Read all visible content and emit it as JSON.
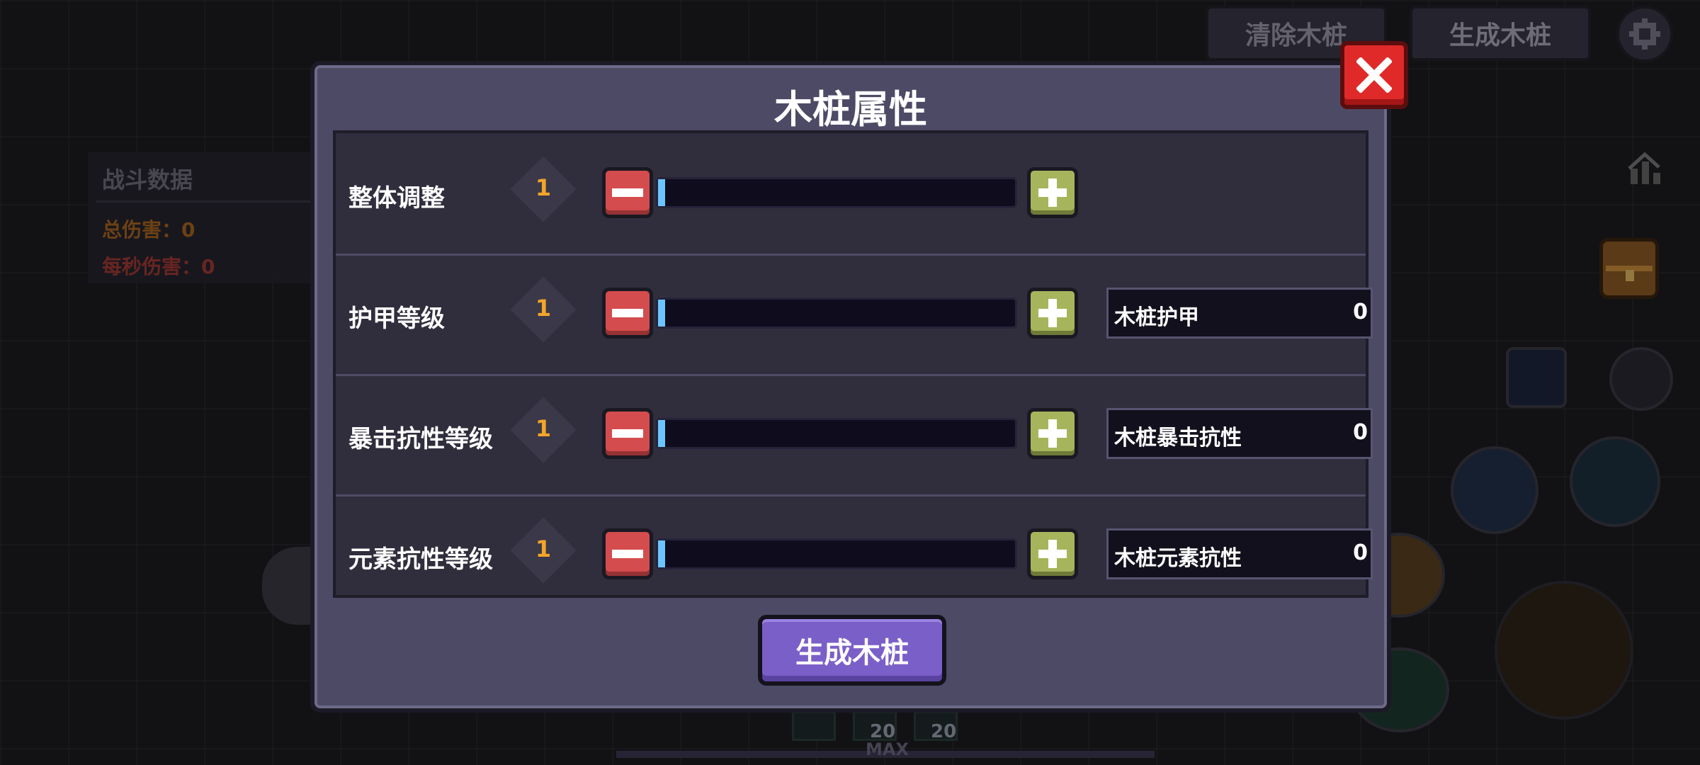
{
  "top_bar": {
    "clear_label": "清除木桩",
    "spawn_label": "生成木桩",
    "settings_icon": "gear-icon"
  },
  "battle_stats": {
    "title": "战斗数据",
    "total_damage": "总伤害：0",
    "dps": "每秒伤害：0",
    "colors": {
      "total": "#a7651f",
      "dps": "#a03a33"
    }
  },
  "dialog": {
    "title": "木桩属性",
    "close_icon": "close-icon",
    "rows": [
      {
        "label": "整体调整",
        "level": "1",
        "fill": 0.02
      },
      {
        "label": "护甲等级",
        "level": "1",
        "fill": 0.02,
        "stat_name": "木桩护甲",
        "stat_value": "0"
      },
      {
        "label": "暴击抗性等级",
        "level": "1",
        "fill": 0.02,
        "stat_name": "木桩暴击抗性",
        "stat_value": "0"
      },
      {
        "label": "元素抗性等级",
        "level": "1",
        "fill": 0.02,
        "stat_name": "木桩元素抗性",
        "stat_value": "0"
      }
    ],
    "generate_label": "生成木桩"
  },
  "hud": {
    "max_label": "MAX",
    "slot_counts": [
      "20",
      "20"
    ]
  }
}
